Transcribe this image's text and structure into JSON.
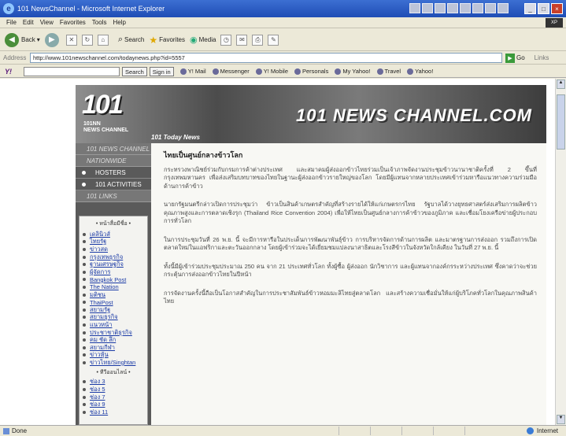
{
  "window": {
    "title": "101 NewsChannel - Microsoft Internet Explorer",
    "app_icon": "ie-icon"
  },
  "menubar": [
    "File",
    "Edit",
    "View",
    "Favorites",
    "Tools",
    "Help"
  ],
  "toolbar": {
    "back": "Back",
    "search": "Search",
    "favorites": "Favorites",
    "media": "Media"
  },
  "address": {
    "label": "Address",
    "url": "http://www.101newschannel.com/todaynews.php?id=5557",
    "go": "Go",
    "links": "Links"
  },
  "yahoo_toolbar": {
    "logo": "Y! ",
    "search_button": "Search",
    "signin": "Sign in",
    "items": [
      "Y! Mail",
      "Messenger",
      "Y! Mobile",
      "Personals",
      "My Yahoo!",
      "Travel",
      "Yahoo!"
    ]
  },
  "site": {
    "logo_number": "101",
    "logo_line1": "101NN",
    "logo_line2": "NEWS CHANNEL",
    "banner_title": "101 NEWS CHANNEL.COM",
    "banner_sub": "101 Today News",
    "nav": [
      "101 NEWS CHANNEL",
      "NATIONWIDE"
    ],
    "nav_items": [
      "HOSTERS",
      "101 ACTIVITIES"
    ],
    "nav_links_header": "101 LINKS",
    "links_heading": "• หน้าสื่อมีชื่อ •",
    "links": [
      "เดลินิวส์",
      "ไทยรัฐ",
      "ข่าวสด",
      "กรุงเทพธุรกิจ",
      "ฐานเศรษฐกิจ",
      "ผู้จัดการ",
      "Bangkok Post",
      "The Nation",
      "มติชน",
      "ThaiPost",
      "สยามรัฐ",
      "สยามธุรกิจ",
      "แนวหน้า",
      "ประชาชาติธุรกิจ",
      "คม ชัด ลึก",
      "สยามกีฬา",
      "ข่าวหุ้น",
      "ข่าวไทย/Singhtan"
    ],
    "links_heading2": "• ทีวีออนไลน์ •",
    "channels": [
      "ช่อง 3",
      "ช่อง 5",
      "ช่อง 7",
      "ช่อง 9",
      "ช่อง 11"
    ]
  },
  "article": {
    "heading": "ไทยเป็นศูนย์กลางข้าวโลก",
    "paragraphs": [
      "กระทรวงพาณิชย์ร่วมกับกรมการค้าต่างประเทศ และสมาคมผู้ส่งออกข้าวไทยร่วมเป็นเจ้าภาพจัดงานประชุมข้าวนานาชาติครั้งที่ 2 ขึ้นที่กรุงเทพมหานคร เพื่อส่งเสริมบทบาทของไทยในฐานะผู้ส่งออกข้าวรายใหญ่ของโลก โดยมีผู้แทนจากหลายประเทศเข้าร่วมหารือแนวทางความร่วมมือด้านการค้าข้าว",
      "นายกรัฐมนตรีกล่าวเปิดการประชุมว่า ข้าวเป็นสินค้าเกษตรสำคัญที่สร้างรายได้ให้แก่เกษตรกรไทย รัฐบาลได้วางยุทธศาสตร์ส่งเสริมการผลิตข้าวคุณภาพสูงและการตลาดเชิงรุก (Thailand Rice Convention 2004) เพื่อให้ไทยเป็นศูนย์กลางการค้าข้าวของภูมิภาค และเชื่อมโยงเครือข่ายผู้ประกอบการทั่วโลก",
      "ในการประชุมวันที่ 26 พ.ย. นี้ จะมีการหารือในประเด็นการพัฒนาพันธุ์ข้าว การบริหารจัดการด้านการผลิต และมาตรฐานการส่งออก รวมถึงการเปิดตลาดใหม่ในแอฟริกาและตะวันออกกลาง โดยผู้เข้าร่วมจะได้เยี่ยมชมแปลงนาสาธิตและโรงสีข้าวในจังหวัดใกล้เคียง ในวันที่ 27 พ.ย. นี้",
      "ทั้งนี้มีผู้เข้าร่วมประชุมประมาณ 250 คน จาก 21 ประเทศทั่วโลก ทั้งผู้ซื้อ ผู้ส่งออก นักวิชาการ และผู้แทนจากองค์กรระหว่างประเทศ ซึ่งคาดว่าจะช่วยกระตุ้นการส่งออกข้าวไทยในปีหน้า",
      "การจัดงานครั้งนี้ถือเป็นโอกาสสำคัญในการประชาสัมพันธ์ข้าวหอมมะลิไทยสู่ตลาดโลก และสร้างความเชื่อมั่นให้แก่ผู้บริโภคทั่วโลกในคุณภาพสินค้าไทย"
    ]
  },
  "status": {
    "left": "Done",
    "zone": "Internet"
  },
  "colors": {
    "title_blue": "#1f4db5",
    "link_blue": "#1a3aa6",
    "nav_gray": "#5a5a5a"
  }
}
